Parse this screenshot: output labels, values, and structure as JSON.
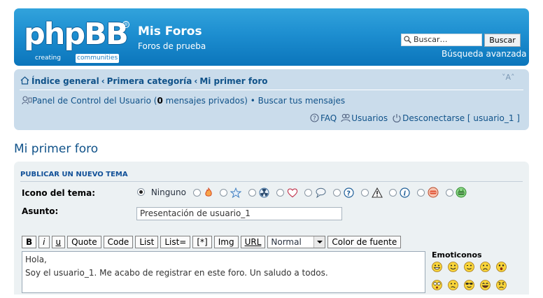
{
  "header": {
    "logo_word": "phpBB",
    "logo_reg": "®",
    "logo_tag_left": "creating",
    "logo_tag_right": "communities",
    "site_title": "Mis Foros",
    "site_description": "Foros de prueba",
    "search_placeholder": "Buscar…",
    "search_button": "Buscar",
    "advanced_search": "Búsqueda avanzada"
  },
  "navbar": {
    "breadcrumbs": [
      "Índice general",
      "Primera categoría",
      "Mi primer foro"
    ],
    "breadcrumb_separator": "‹",
    "font_size_control": "˅A˄",
    "ucp_text_before": "Panel de Control del Usuario (",
    "ucp_count": "0",
    "ucp_text_after": " mensajes privados)",
    "ucp_bullet": " • ",
    "search_own_posts": "Buscar tus mensajes",
    "faq": "FAQ",
    "members": "Usuarios",
    "logout": "Desconectarse [ usuario_1 ]"
  },
  "forum_title": "Mi primer foro",
  "post_form": {
    "heading": "PUBLICAR UN NUEVO TEMA",
    "topic_icon_label": "Icono del tema:",
    "topic_icon_none": "Ninguno",
    "topic_icons": [
      "fire-icon",
      "star-icon",
      "radioactive-icon",
      "heart-icon",
      "speech-bubble-icon",
      "question-icon",
      "warning-icon",
      "info-icon",
      "thumbs-down-icon",
      "thumbs-up-icon"
    ],
    "subject_label": "Asunto:",
    "subject_value": "Presentación de usuario_1",
    "toolbar": {
      "bold": "B",
      "italic": "i",
      "underline": "u",
      "quote": "Quote",
      "code": "Code",
      "list": "List",
      "list_ordered": "List=",
      "list_item": "[*]",
      "img": "Img",
      "url": "URL",
      "font_size": "Normal",
      "font_color": "Color de fuente"
    },
    "message_line1": "Hola,",
    "message_line2": "Soy el usuario_1. Me acabo de registrar en este foro. Un saludo a todos.",
    "smilies_title": "Emoticonos",
    "smilies": [
      "very-happy-icon",
      "smile-icon",
      "wink-icon",
      "sad-icon",
      "surprised-icon",
      "shocked-icon",
      "confused-icon",
      "cool-icon",
      "laughing-icon",
      "mad-icon"
    ]
  },
  "colors": {
    "header_blue": "#1d8ed0",
    "navbar_bg": "#cadceb",
    "link_blue": "#105289",
    "panel_bg": "#ecf1f3"
  }
}
